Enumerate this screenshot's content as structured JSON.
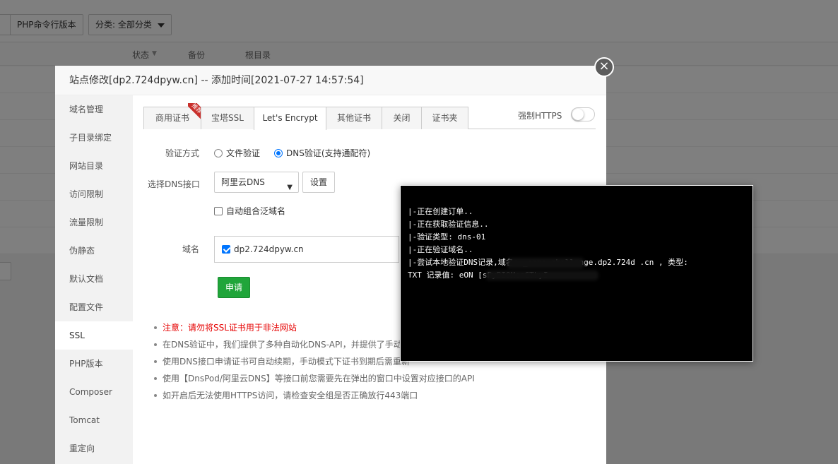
{
  "background": {
    "toolbar": {
      "php_cli_button": "PHP命令行版本",
      "category_select": "分类: 全部分类"
    },
    "table_headers": [
      "状态",
      "备份",
      "根目录"
    ]
  },
  "modal": {
    "title": "站点修改[dp2.724dpyw.cn] -- 添加时间[2021-07-27 14:57:54]",
    "close": "×",
    "sidebar": [
      {
        "label": "域名管理"
      },
      {
        "label": "子目录绑定"
      },
      {
        "label": "网站目录"
      },
      {
        "label": "访问限制"
      },
      {
        "label": "流量限制"
      },
      {
        "label": "伪静态"
      },
      {
        "label": "默认文档"
      },
      {
        "label": "配置文件"
      },
      {
        "label": "SSL"
      },
      {
        "label": "PHP版本"
      },
      {
        "label": "Composer"
      },
      {
        "label": "Tomcat"
      },
      {
        "label": "重定向"
      }
    ],
    "active_sidebar": "SSL",
    "tabs": [
      {
        "label": "商用证书",
        "badge": "推荐"
      },
      {
        "label": "宝塔SSL"
      },
      {
        "label": "Let's Encrypt"
      },
      {
        "label": "其他证书"
      },
      {
        "label": "关闭"
      },
      {
        "label": "证书夹"
      }
    ],
    "active_tab": "Let's Encrypt",
    "force_https_label": "强制HTTPS",
    "force_https_enabled": false,
    "verify": {
      "label": "验证方式",
      "options": [
        "文件验证",
        "DNS验证(支持通配符)"
      ],
      "selected": "DNS验证(支持通配符)"
    },
    "dns": {
      "label": "选择DNS接口",
      "selected": "阿里云DNS",
      "settings_button": "设置",
      "auto_wildcard_label": "自动组合泛域名",
      "auto_wildcard_checked": false
    },
    "domain": {
      "label": "域名",
      "item": "dp2.724dpyw.cn",
      "checked": true
    },
    "apply_button": "申请",
    "notes": [
      "注意：请勿将SSL证书用于非法网站",
      "在DNS验证中，我们提供了多种自动化DNS-API，并提供了手动模",
      "使用DNS接口申请证书可自动续期，手动模式下证书到期后需重新",
      "使用【DnsPod/阿里云DNS】等接口前您需要先在弹出的窗口中设置对应接口的API",
      "如开启后无法使用HTTPS访问，请检查安全组是否正确放行443端口"
    ]
  },
  "terminal": {
    "lines": [
      "|-正在创建订单..",
      "|-正在获取验证信息..",
      "|-验证类型: dns-01",
      "|-正在验证域名..",
      "|-尝试本地验证DNS记录,域名: _acme-challenge.dp2.724d    .cn , 类型:",
      "TXT 记录值: eON                       [sPyBIOMenCTkyI"
    ]
  },
  "colors": {
    "primary_green": "#20a53a",
    "warn_red": "#e60000",
    "terminal_bg": "#000000"
  }
}
